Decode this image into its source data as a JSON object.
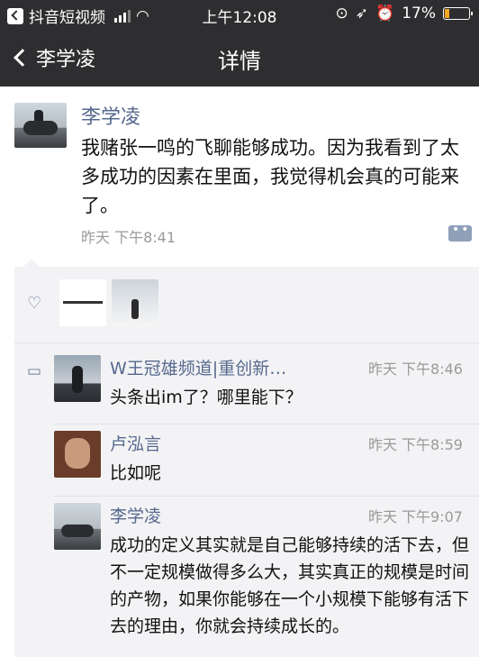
{
  "status_bar": {
    "app_back": "抖音短视频",
    "time": "上午12:08",
    "battery": "17%",
    "icons": [
      "signal-icon",
      "wifi-icon",
      "lock-rotation-icon",
      "location-icon",
      "alarm-icon",
      "battery-icon"
    ]
  },
  "nav": {
    "back_label": "李学凌",
    "title": "详情"
  },
  "post": {
    "author": "李学凌",
    "text": "我赌张一鸣的飞聊能够成功。因为我看到了太多成功的因素在里面，我觉得机会真的可能来了。",
    "time": "昨天 下午8:41"
  },
  "likes": {
    "icon": "heart-icon"
  },
  "comments": [
    {
      "name": "W王冠雄频道|重创新…",
      "time": "昨天 下午8:46",
      "text": "头条出im了？哪里能下？"
    },
    {
      "name": "卢泓言",
      "time": "昨天 下午8:59",
      "text": "比如呢"
    },
    {
      "name": "李学凌",
      "time": "昨天 下午9:07",
      "text": "成功的定义其实就是自己能够持续的活下去，但不一定规模做得多么大，其实真正的规模是时间的产物，如果你能够在一个小规模下能够有活下去的理由，你就会持续成长的。"
    }
  ],
  "colors": {
    "nav_bg": "#2e2e30",
    "name_link": "#56688e",
    "panel_bg": "#f3f3f5",
    "battery_low": "#f5a623"
  }
}
